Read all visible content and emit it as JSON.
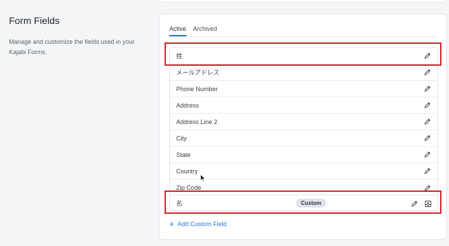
{
  "sidebar": {
    "title": "Form Fields",
    "description": "Manage and customize the fields used in your Kajabi Forms."
  },
  "tabs": [
    {
      "label": "Active",
      "active": true
    },
    {
      "label": "Archived",
      "active": false
    }
  ],
  "fields": [
    {
      "label": "姓"
    },
    {
      "label": "メールアドレス"
    },
    {
      "label": "Phone Number"
    },
    {
      "label": "Address"
    },
    {
      "label": "Address Line 2"
    },
    {
      "label": "City"
    },
    {
      "label": "State"
    },
    {
      "label": "Country"
    },
    {
      "label": "Zip Code"
    }
  ],
  "custom_field": {
    "label": "名",
    "badge": "Custom"
  },
  "add_custom_field": "Add Custom Field",
  "colors": {
    "accent": "#2b73e0",
    "highlight": "#d6202a",
    "background": "#f4f5f7"
  },
  "icons": {
    "edit": "pencil-icon",
    "archive": "archive-box-icon",
    "add": "plus-icon"
  }
}
